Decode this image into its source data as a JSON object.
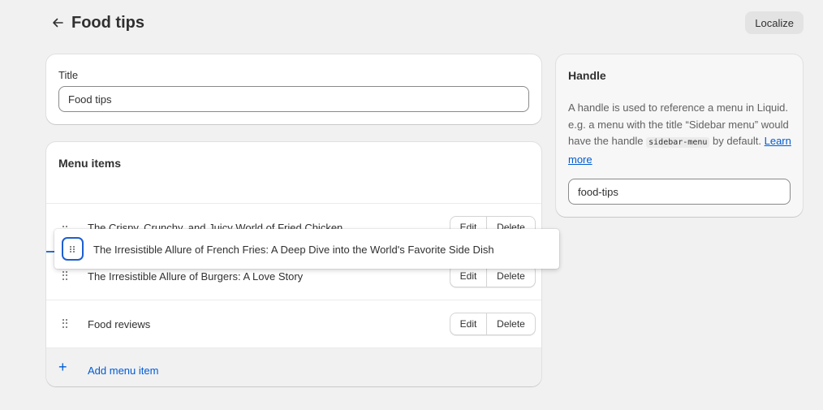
{
  "header": {
    "title": "Food tips",
    "localize_label": "Localize"
  },
  "title_card": {
    "label": "Title",
    "value": "Food tips"
  },
  "menu_card": {
    "heading": "Menu items",
    "edit_label": "Edit",
    "delete_label": "Delete",
    "items": [
      {
        "label": "The Crispy, Crunchy, and Juicy World of Fried Chicken"
      },
      {
        "label": "The Irresistible Allure of Burgers: A Love Story"
      },
      {
        "label": "Food reviews"
      }
    ],
    "add_label": "Add menu item",
    "add_icon": "+"
  },
  "dragging_item": {
    "label": "The Irresistible Allure of French Fries: A Deep Dive into the World's Favorite Side Dish"
  },
  "handle_card": {
    "heading": "Handle",
    "desc_part1": "A handle is used to reference a menu in Liquid. e.g. a menu with the title “Sidebar menu” would have the handle ",
    "desc_code": "sidebar-menu",
    "desc_part2": " by default. ",
    "learn_more": "Learn more",
    "value": "food-tips"
  },
  "colors": {
    "accent": "#005bd3",
    "focus_ring": "#1e5fd0",
    "background": "#f1f1f1"
  }
}
